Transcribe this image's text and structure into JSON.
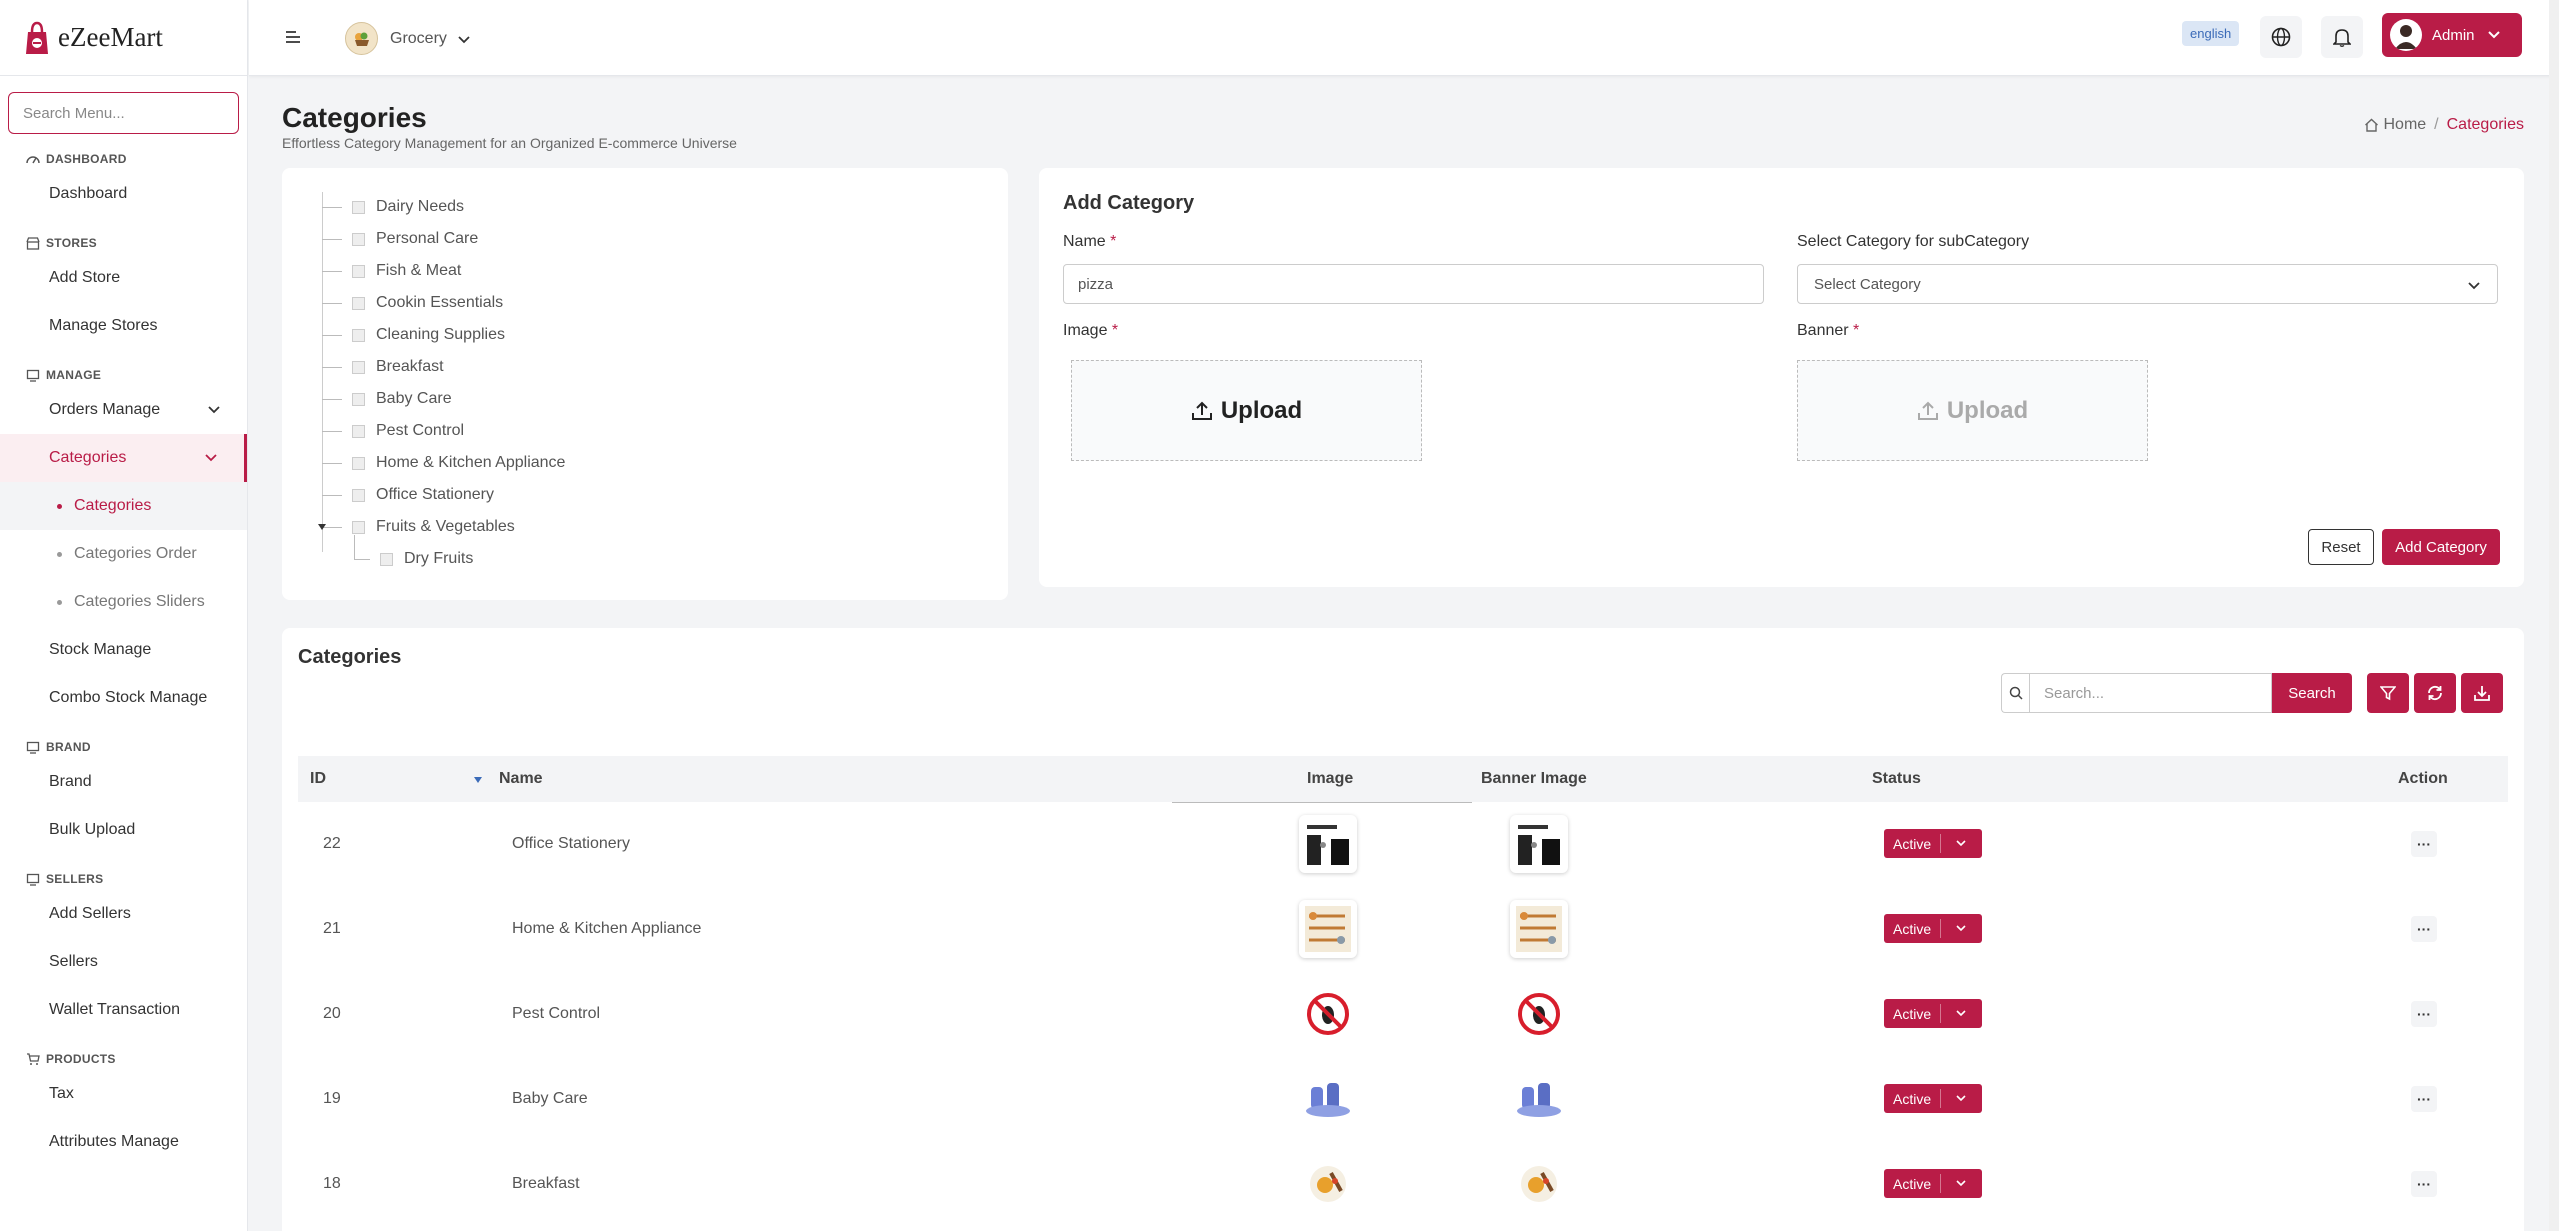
{
  "app": {
    "name": "eZeeMart"
  },
  "colors": {
    "brand": "#b91c47",
    "background": "#f3f4f6"
  },
  "sidebar": {
    "search_placeholder": "Search Menu...",
    "sections": {
      "dashboard": {
        "title": "DASHBOARD",
        "items": [
          "Dashboard"
        ]
      },
      "stores": {
        "title": "STORES",
        "items": [
          "Add Store",
          "Manage Stores"
        ]
      },
      "manage": {
        "title": "MANAGE",
        "orders": "Orders Manage",
        "categories": "Categories",
        "sub_items": [
          "Categories",
          "Categories Order",
          "Categories Sliders"
        ],
        "stock": "Stock Manage",
        "combo": "Combo Stock Manage"
      },
      "brand": {
        "title": "BRAND",
        "items": [
          "Brand",
          "Bulk Upload"
        ]
      },
      "sellers": {
        "title": "SELLERS",
        "items": [
          "Add Sellers",
          "Sellers",
          "Wallet Transaction"
        ]
      },
      "products": {
        "title": "PRODUCTS",
        "items": [
          "Tax",
          "Attributes Manage"
        ]
      }
    }
  },
  "topbar": {
    "store": "Grocery",
    "language": "english",
    "user": "Admin"
  },
  "header": {
    "title": "Categories",
    "subtitle": "Effortless Category Management for an Organized E-commerce Universe",
    "breadcrumb": {
      "home": "Home",
      "current": "Categories"
    }
  },
  "tree": {
    "items": [
      "Dairy Needs",
      "Personal Care",
      "Fish & Meat",
      "Cookin Essentials",
      "Cleaning Supplies",
      "Breakfast",
      "Baby Care",
      "Pest Control",
      "Home & Kitchen Appliance",
      "Office Stationery",
      "Fruits & Vegetables"
    ],
    "child": "Dry Fruits"
  },
  "add_category": {
    "title": "Add Category",
    "name_label": "Name",
    "name_value": "pizza",
    "parent_label": "Select Category for subCategory",
    "parent_placeholder": "Select Category",
    "image_label": "Image",
    "banner_label": "Banner",
    "upload_label": "Upload",
    "required_mark": "*",
    "reset": "Reset",
    "submit": "Add Category"
  },
  "list": {
    "title": "Categories",
    "search_placeholder": "Search...",
    "search_button": "Search",
    "columns": {
      "id": "ID",
      "name": "Name",
      "image": "Image",
      "banner": "Banner Image",
      "status": "Status",
      "action": "Action"
    },
    "rows": [
      {
        "id": "22",
        "name": "Office Stationery",
        "status": "Active",
        "thumb": "stationery"
      },
      {
        "id": "21",
        "name": "Home & Kitchen Appliance",
        "status": "Active",
        "thumb": "kitchen"
      },
      {
        "id": "20",
        "name": "Pest Control",
        "status": "Active",
        "thumb": "pest"
      },
      {
        "id": "19",
        "name": "Baby Care",
        "status": "Active",
        "thumb": "baby"
      },
      {
        "id": "18",
        "name": "Breakfast",
        "status": "Active",
        "thumb": "breakfast"
      }
    ],
    "action_glyph": "···"
  }
}
